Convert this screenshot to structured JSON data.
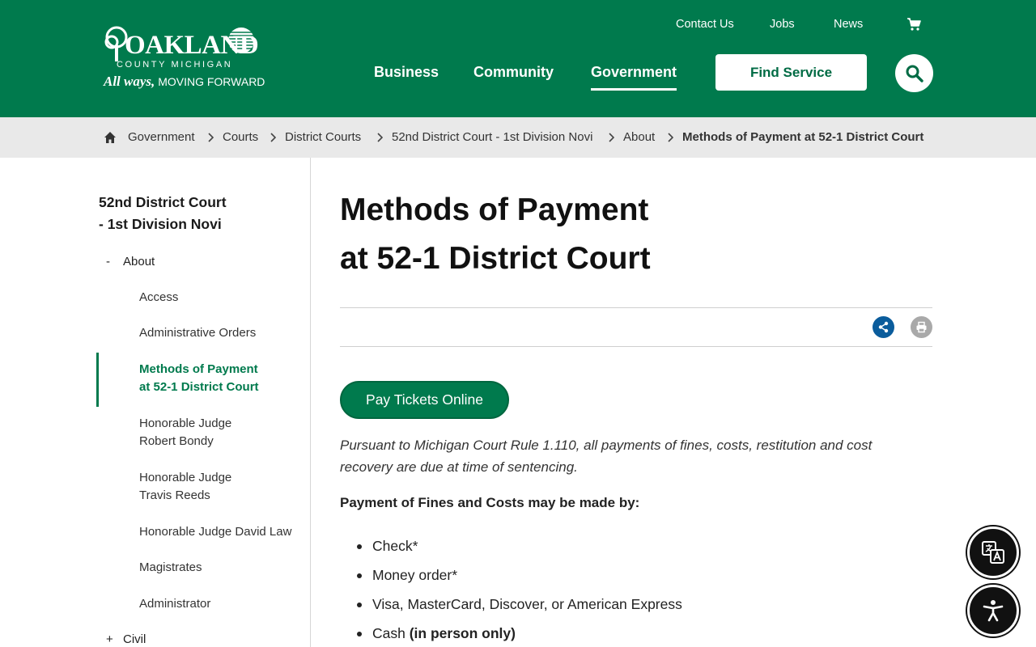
{
  "header": {
    "logo": {
      "wordmark": "OAKLAND",
      "county": "COUNTY MICHIGAN",
      "tagline_script": "All ways,",
      "tagline_rest": "MOVING FORWARD"
    },
    "utility_links": [
      "Contact Us",
      "Jobs",
      "News"
    ],
    "cart_icon": "cart-icon",
    "main_nav": [
      "Business",
      "Community",
      "Government"
    ],
    "active_nav": "Government",
    "find_service_label": "Find Service",
    "search_icon": "search-icon"
  },
  "breadcrumb": {
    "home_icon": "home-icon",
    "items": [
      "Government",
      "Courts",
      "District Courts",
      "52nd District Court - 1st Division Novi",
      "About",
      "Methods of Payment at 52-1 District Court"
    ]
  },
  "sidebar": {
    "title_line1": "52nd District Court",
    "title_line2": "- 1st Division Novi",
    "section_about": {
      "toggle": "-",
      "label": "About"
    },
    "items": [
      {
        "line1": "Access",
        "line2": ""
      },
      {
        "line1": "Administrative Orders",
        "line2": ""
      },
      {
        "line1": "Methods of Payment",
        "line2": "at 52-1 District Court"
      },
      {
        "line1": "Honorable Judge",
        "line2": "Robert Bondy"
      },
      {
        "line1": "Honorable Judge",
        "line2": "Travis Reeds"
      },
      {
        "line1": "Honorable Judge David Law",
        "line2": ""
      },
      {
        "line1": "Magistrates",
        "line2": ""
      },
      {
        "line1": "Administrator",
        "line2": ""
      }
    ],
    "active_item": "Methods of Payment at 52-1 District Court",
    "section_civil": {
      "toggle": "+",
      "label": "Civil"
    }
  },
  "main": {
    "title_line1": "Methods of Payment",
    "title_line2": "at 52-1 District Court",
    "share_icon": "share-icon",
    "print_icon": "print-icon",
    "pay_button": "Pay Tickets Online",
    "intro": "Pursuant to Michigan Court Rule 1.110, all payments of fines, costs, restitution and cost recovery are due at time of sentencing.",
    "subhead": "Payment of Fines and Costs may be made by:",
    "payment_methods": [
      "Check*",
      "Money order*",
      "Visa, MasterCard, Discover, or American Express"
    ],
    "cash": {
      "label": "Cash ",
      "note": "(in person only)"
    }
  },
  "floating": {
    "translate_icon": "translate-icon",
    "accessibility_icon": "accessibility-icon"
  },
  "colors": {
    "brand_green": "#007a4d",
    "share_blue": "#0a5c9c",
    "print_gray": "#a9a9a9",
    "breadcrumb_bg": "#e9e9e9"
  }
}
